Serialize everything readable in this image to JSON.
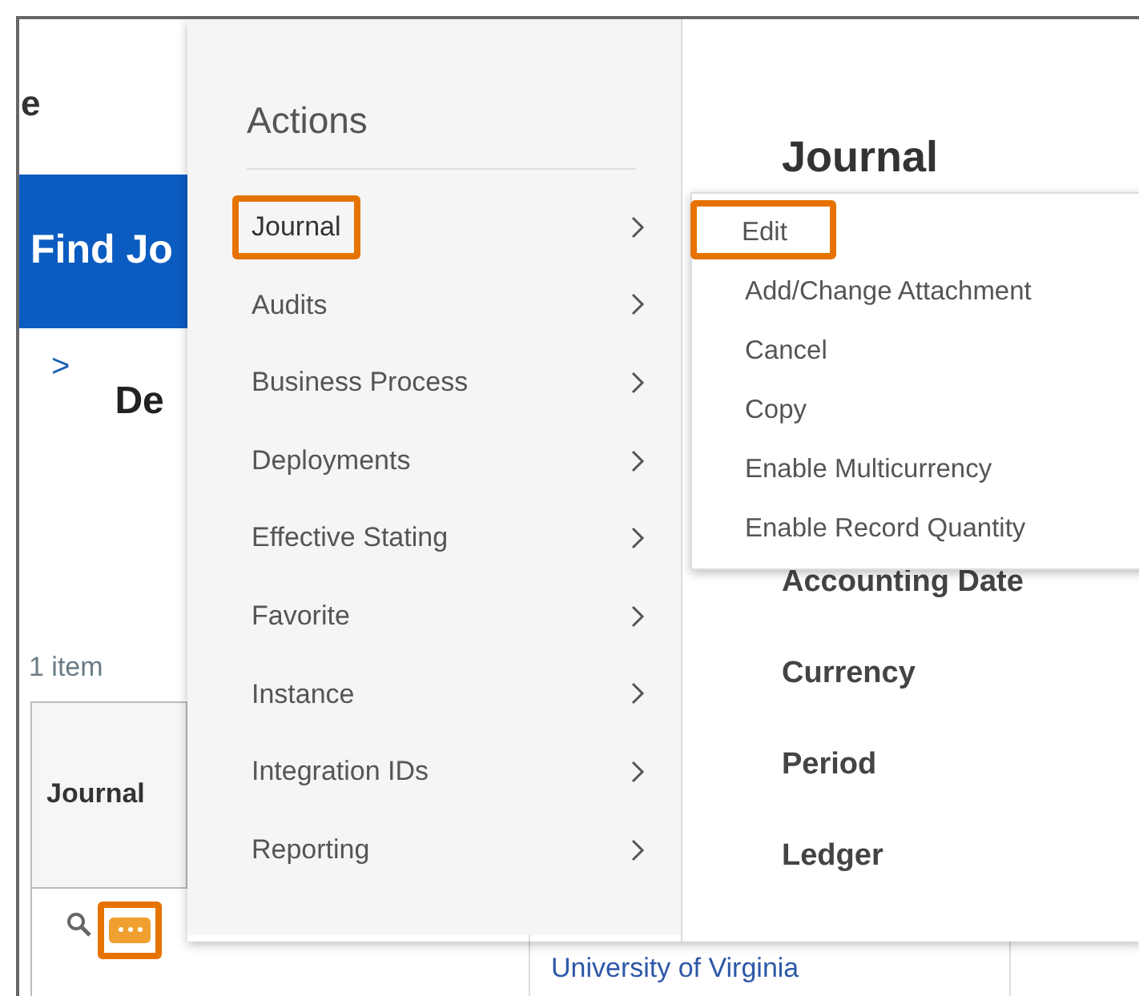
{
  "background_page": {
    "title_fragment": "e",
    "banner": "Find Jo",
    "expand_arrow": ">",
    "heading_fragment": "De",
    "item_count": "1 item",
    "table": {
      "columns": [
        "Journal"
      ],
      "row_link": "University of Virginia",
      "row_actions_highlighted": true
    }
  },
  "actions_menu": {
    "title": "Actions",
    "items": [
      {
        "label": "Journal",
        "highlighted": true,
        "expanded": true
      },
      {
        "label": "Audits",
        "highlighted": false,
        "expanded": false
      },
      {
        "label": "Business Process",
        "highlighted": false,
        "expanded": false
      },
      {
        "label": "Deployments",
        "highlighted": false,
        "expanded": false
      },
      {
        "label": "Effective Stating",
        "highlighted": false,
        "expanded": false
      },
      {
        "label": "Favorite",
        "highlighted": false,
        "expanded": false
      },
      {
        "label": "Instance",
        "highlighted": false,
        "expanded": false
      },
      {
        "label": "Integration IDs",
        "highlighted": false,
        "expanded": false
      },
      {
        "label": "Reporting",
        "highlighted": false,
        "expanded": false
      }
    ]
  },
  "detail_panel": {
    "title": "Journal",
    "fields": [
      "Accounting Date",
      "Currency",
      "Period",
      "Ledger"
    ]
  },
  "submenu": {
    "items": [
      {
        "label": "Edit",
        "highlighted": true
      },
      {
        "label": "Add/Change Attachment",
        "highlighted": false
      },
      {
        "label": "Cancel",
        "highlighted": false
      },
      {
        "label": "Copy",
        "highlighted": false
      },
      {
        "label": "Enable Multicurrency",
        "highlighted": false
      },
      {
        "label": "Enable Record Quantity",
        "highlighted": false
      }
    ]
  }
}
